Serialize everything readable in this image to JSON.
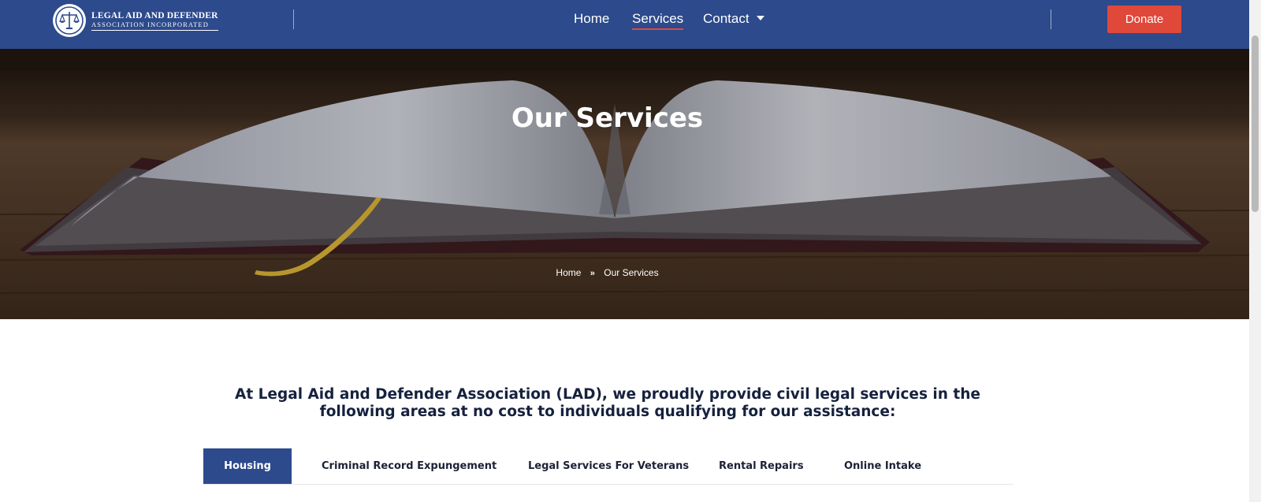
{
  "header": {
    "logo": {
      "line1": "LEGAL AID AND DEFENDER",
      "line2": "ASSOCIATION INCORPORATED",
      "icon": "scales-of-justice-icon"
    },
    "nav": {
      "home": "Home",
      "services": "Services",
      "contact": "Contact",
      "active": "Services"
    },
    "donate_label": "Donate"
  },
  "hero": {
    "title": "Our Services",
    "breadcrumb": {
      "home": "Home",
      "separator_icon": "double-chevron-right-icon",
      "current": "Our Services"
    }
  },
  "intro": {
    "text": "At Legal Aid and Defender Association (LAD), we proudly provide civil legal services in the following areas at no cost to individuals qualifying for our assistance:"
  },
  "tabs": {
    "items": [
      "Housing",
      "Criminal Record Expungement",
      "Legal Services For Veterans",
      "Rental Repairs",
      "Online Intake"
    ],
    "active": "Housing"
  },
  "colors": {
    "brand_blue": "#2c4a8c",
    "accent_red": "#e0483a",
    "text_dark": "#16213e"
  }
}
